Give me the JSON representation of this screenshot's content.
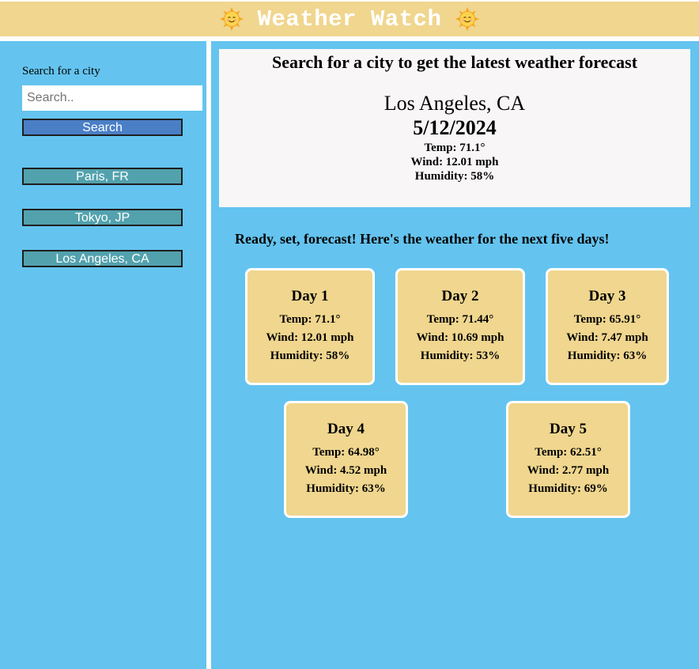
{
  "header": {
    "title": "Weather Watch",
    "icon": "smiling-sun-icon"
  },
  "sidebar": {
    "search_label": "Search for a city",
    "search_placeholder": "Search..",
    "search_value": "",
    "search_button": "Search",
    "history": [
      "Paris, FR",
      "Tokyo, JP",
      "Los Angeles, CA"
    ]
  },
  "current": {
    "prompt": "Search for a city to get the latest weather forecast",
    "city": "Los Angeles, CA",
    "date": "5/12/2024",
    "temp": "Temp: 71.1°",
    "wind": "Wind: 12.01 mph",
    "humidity": "Humidity: 58%"
  },
  "forecast": {
    "heading": "Ready, set, forecast! Here's the weather for the next five days!",
    "days": [
      {
        "label": "Day 1",
        "temp": "Temp: 71.1°",
        "wind": "Wind: 12.01 mph",
        "humidity": "Humidity: 58%"
      },
      {
        "label": "Day 2",
        "temp": "Temp: 71.44°",
        "wind": "Wind: 10.69 mph",
        "humidity": "Humidity: 53%"
      },
      {
        "label": "Day 3",
        "temp": "Temp: 65.91°",
        "wind": "Wind: 7.47 mph",
        "humidity": "Humidity: 63%"
      },
      {
        "label": "Day 4",
        "temp": "Temp: 64.98°",
        "wind": "Wind: 4.52 mph",
        "humidity": "Humidity: 63%"
      },
      {
        "label": "Day 5",
        "temp": "Temp: 62.51°",
        "wind": "Wind: 2.77 mph",
        "humidity": "Humidity: 69%"
      }
    ]
  },
  "colors": {
    "header_bg": "#f0d68e",
    "panel_bg": "#64c4ef",
    "search_button": "#4a7fc6",
    "history_button": "#52a2ae",
    "card_bg": "#f0d68e"
  }
}
